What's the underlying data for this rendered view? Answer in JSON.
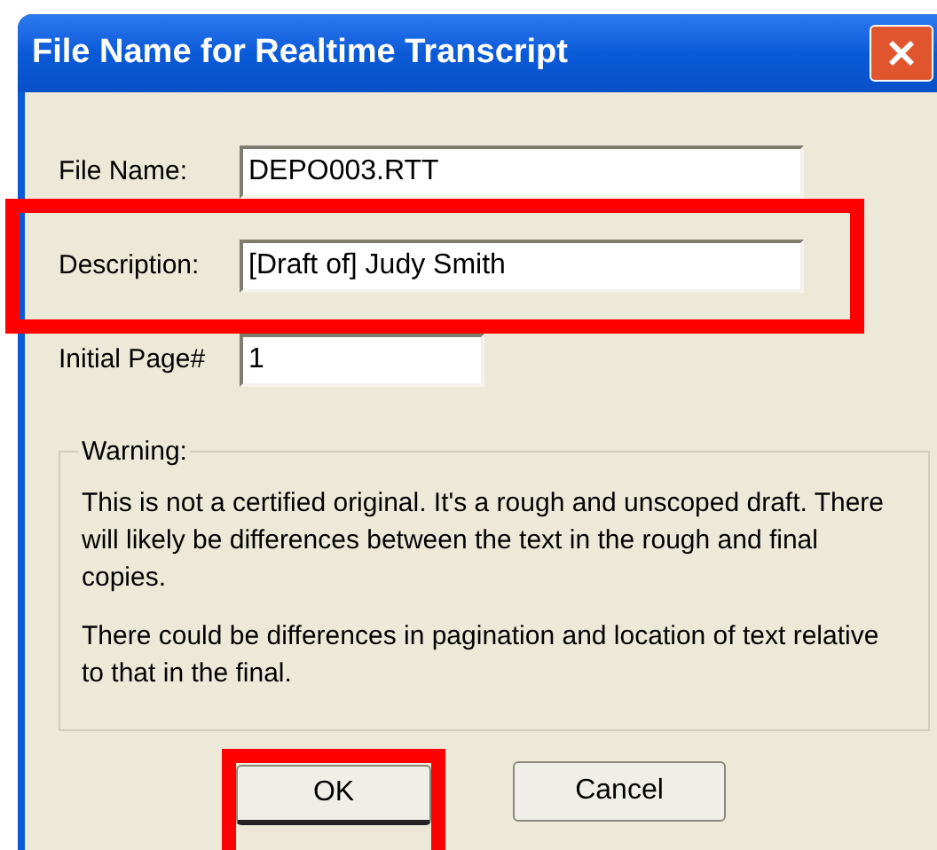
{
  "window": {
    "title": "File Name for Realtime Transcript"
  },
  "fields": [
    {
      "label": "File Name:",
      "value": "DEPO003.RTT",
      "highlighted": false,
      "kind": "wide"
    },
    {
      "label": "Description:",
      "value": "[Draft of] Judy Smith",
      "highlighted": true,
      "kind": "wide"
    },
    {
      "label": "Initial Page#",
      "value": "1",
      "highlighted": false,
      "kind": "short"
    }
  ],
  "warning": {
    "title": "Warning:",
    "paragraphs": [
      "This is not a certified original. It's a rough and unscoped draft. There will likely be differences between the text in the rough and final copies.",
      "There could be differences in pagination and location of text relative to that in the final."
    ]
  },
  "buttons": [
    {
      "label": "OK",
      "default": true,
      "highlighted": true
    },
    {
      "label": "Cancel",
      "default": false,
      "highlighted": false
    }
  ]
}
